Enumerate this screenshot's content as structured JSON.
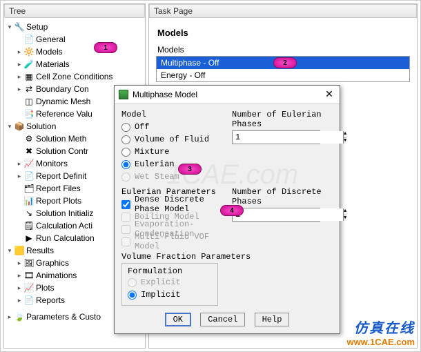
{
  "left": {
    "title": "Tree",
    "nodes": {
      "setup": {
        "label": "Setup",
        "icon": "🔧",
        "exp": "▾"
      },
      "general": {
        "label": "General",
        "icon": "📄"
      },
      "models": {
        "label": "Models",
        "icon": "🔆",
        "exp": "▸"
      },
      "materials": {
        "label": "Materials",
        "icon": "🧪",
        "exp": "▸"
      },
      "cellzone": {
        "label": "Cell Zone Conditions",
        "icon": "▦",
        "exp": "▸"
      },
      "boundary": {
        "label": "Boundary Con",
        "icon": "⇄",
        "exp": "▸"
      },
      "dynmesh": {
        "label": "Dynamic Mesh",
        "icon": "◫"
      },
      "refvals": {
        "label": "Reference Valu",
        "icon": "📑"
      },
      "solution": {
        "label": "Solution",
        "icon": "📦",
        "exp": "▾"
      },
      "solmethods": {
        "label": "Solution Meth",
        "icon": "⚙"
      },
      "solcontrols": {
        "label": "Solution Contr",
        "icon": "✖"
      },
      "monitors": {
        "label": "Monitors",
        "icon": "📈",
        "exp": "▸"
      },
      "repdefs": {
        "label": "Report Definit",
        "icon": "📄",
        "exp": "▸"
      },
      "repfiles": {
        "label": "Report Files",
        "icon": "🗂"
      },
      "repplots": {
        "label": "Report Plots",
        "icon": "📊"
      },
      "solinit": {
        "label": "Solution Initializ",
        "icon": "↘"
      },
      "calcact": {
        "label": "Calculation Acti",
        "icon": "🗒"
      },
      "runcalc": {
        "label": "Run Calculation",
        "icon": "▶"
      },
      "results": {
        "label": "Results",
        "icon": "🟨",
        "exp": "▾"
      },
      "graphics": {
        "label": "Graphics",
        "icon": "🖼",
        "exp": "▸"
      },
      "animations": {
        "label": "Animations",
        "icon": "🎞",
        "exp": "▸"
      },
      "plots": {
        "label": "Plots",
        "icon": "📈",
        "exp": "▸"
      },
      "reports": {
        "label": "Reports",
        "icon": "📄",
        "exp": "▸"
      },
      "params": {
        "label": "Parameters & Custo",
        "icon": "🍃",
        "exp": "▸"
      }
    }
  },
  "right": {
    "title": "Task Page",
    "heading": "Models",
    "list_label": "Models",
    "items": [
      {
        "label": "Multiphase - Off",
        "selected": true
      },
      {
        "label": "Energy - Off",
        "selected": false
      }
    ]
  },
  "dialog": {
    "title": "Multiphase Model",
    "groups": {
      "model": {
        "label": "Model",
        "options": [
          {
            "label": "Off"
          },
          {
            "label": "Volume of Fluid"
          },
          {
            "label": "Mixture"
          },
          {
            "label": "Eulerian",
            "checked": true
          },
          {
            "label": "Wet Steam",
            "disabled": true
          }
        ]
      },
      "eulerian_phases": {
        "label": "Number of Eulerian Phases",
        "value": "1"
      },
      "eparams": {
        "label": "Eulerian Parameters",
        "checks": [
          {
            "label": "Dense Discrete Phase Model",
            "checked": true
          },
          {
            "label": "Boiling Model",
            "disabled": true
          },
          {
            "label": "Evaporation-Condensation",
            "disabled": true
          },
          {
            "label": "Multi-Fluid VOF Model",
            "disabled": true
          }
        ]
      },
      "discrete_phases": {
        "label": "Number of Discrete Phases",
        "value": "1"
      },
      "vfp": {
        "label": "Volume Fraction Parameters",
        "sub": "Formulation",
        "options": [
          {
            "label": "Explicit",
            "disabled": true
          },
          {
            "label": "Implicit",
            "checked": true
          }
        ]
      }
    },
    "buttons": {
      "ok": "OK",
      "cancel": "Cancel",
      "help": "Help"
    }
  },
  "markers": {
    "m1": "1",
    "m2": "2",
    "m3": "3",
    "m4": "4"
  },
  "watermark": {
    "cn": "仿真在线",
    "url": "www.1CAE.com"
  }
}
